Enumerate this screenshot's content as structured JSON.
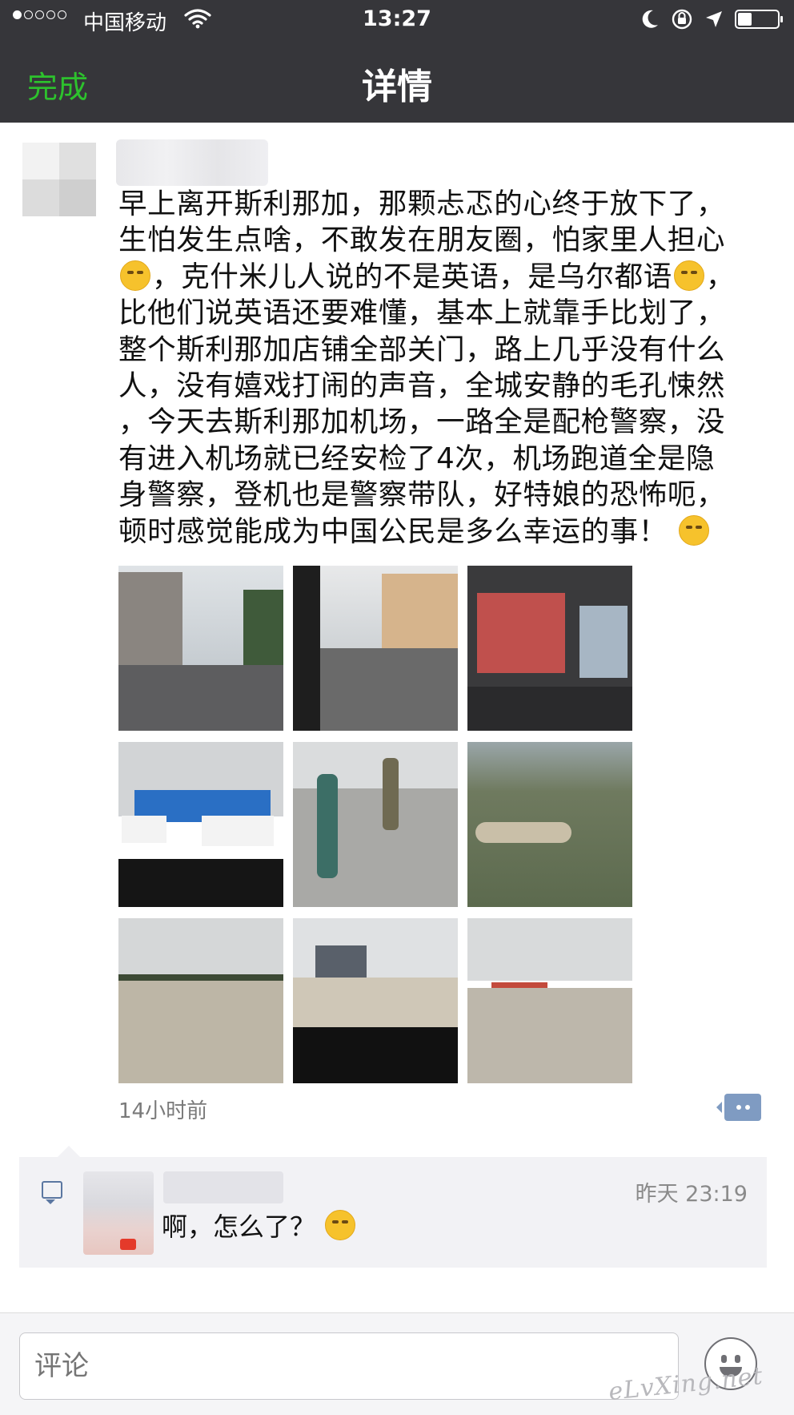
{
  "status_bar": {
    "carrier": "中国移动",
    "time": "13:27",
    "battery_level": 0.35
  },
  "nav": {
    "done_label": "完成",
    "title": "详情"
  },
  "post": {
    "text_lines": [
      "早上离开斯利那加，那颗忐忑的心终于放下了，",
      "生怕发生点啥，不敢发在朋友圈，怕家里人担心",
      "，克什米儿人说的不是英语，是乌尔都语",
      "，",
      "比他们说英语还要难懂，基本上就靠手比划了，",
      "整个斯利那加店铺全部关门，路上几乎没有什么",
      "人，没有嬉戏打闹的声音，全城安静的毛孔悚然",
      "，今天去斯利那加机场，一路全是配枪警察，没",
      "有进入机场就已经安检了4次，机场跑道全是隐",
      "身警察，登机也是警察带队，好特娘的恐怖呃，",
      "顿时感觉能成为中国公民是多么幸运的事！"
    ],
    "emojis": [
      "smirk-emoji",
      "crying-emoji",
      "grin-emoji"
    ],
    "time_ago": "14小时前"
  },
  "comment": {
    "time": "昨天 23:19",
    "text": "啊，怎么了？"
  },
  "input_bar": {
    "placeholder": "评论"
  },
  "watermark": "eLvXing.net",
  "colors": {
    "nav_bg": "#36363a",
    "done_green": "#2dc22d",
    "link_blue": "#5b77a1"
  }
}
